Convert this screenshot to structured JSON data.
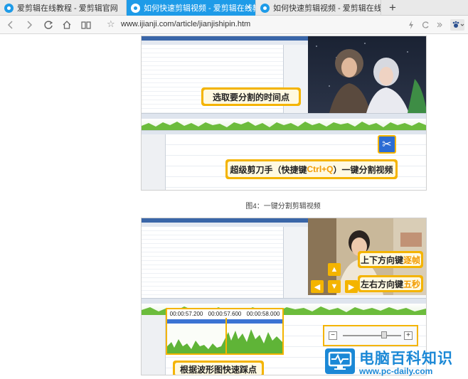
{
  "browser": {
    "tabs": [
      {
        "title": "爱剪辑在线教程 - 爱剪辑官网",
        "active": false
      },
      {
        "title": "如何快速剪辑视频 - 爱剪辑在线教程",
        "active": true
      },
      {
        "title": "如何快速剪辑视频 - 爱剪辑在线教程",
        "active": false
      }
    ],
    "close_glyph": "×",
    "new_tab_glyph": "+",
    "url": "www.ijianji.com/article/jianjishipin.htm",
    "icons": [
      "back-icon",
      "forward-icon",
      "reload-icon",
      "home-icon",
      "reader-icon",
      "star-icon",
      "lightning-icon",
      "refresh-icon",
      "menu-icon",
      "paw-icon"
    ]
  },
  "article": {
    "figure1": {
      "callout_top": "选取要分割的时间点",
      "callout_bottom_prefix": "超级剪刀手（快捷键",
      "callout_bottom_key": "Ctrl+Q",
      "callout_bottom_suffix": "）一键分割视频",
      "caption": "图4：一键分割剪辑视频"
    },
    "figure2": {
      "callout_updown_prefix": "上下方向键",
      "callout_updown_hl": "逐帧",
      "callout_leftright_prefix": "左右方向键",
      "callout_leftright_hl": "五秒",
      "timecodes": [
        "00:00:57.200",
        "00:00:57.600",
        "00:00:58.000"
      ],
      "callout_bottom": "根据波形图快速踩点",
      "zoom_minus": "−",
      "zoom_plus": "+"
    }
  },
  "watermark": {
    "title": "电脑百科知识",
    "url": "www.pc-daily.com"
  },
  "colors": {
    "accent": "#1e9be8",
    "callout": "#f4b400",
    "logo": "#1b88d6"
  }
}
